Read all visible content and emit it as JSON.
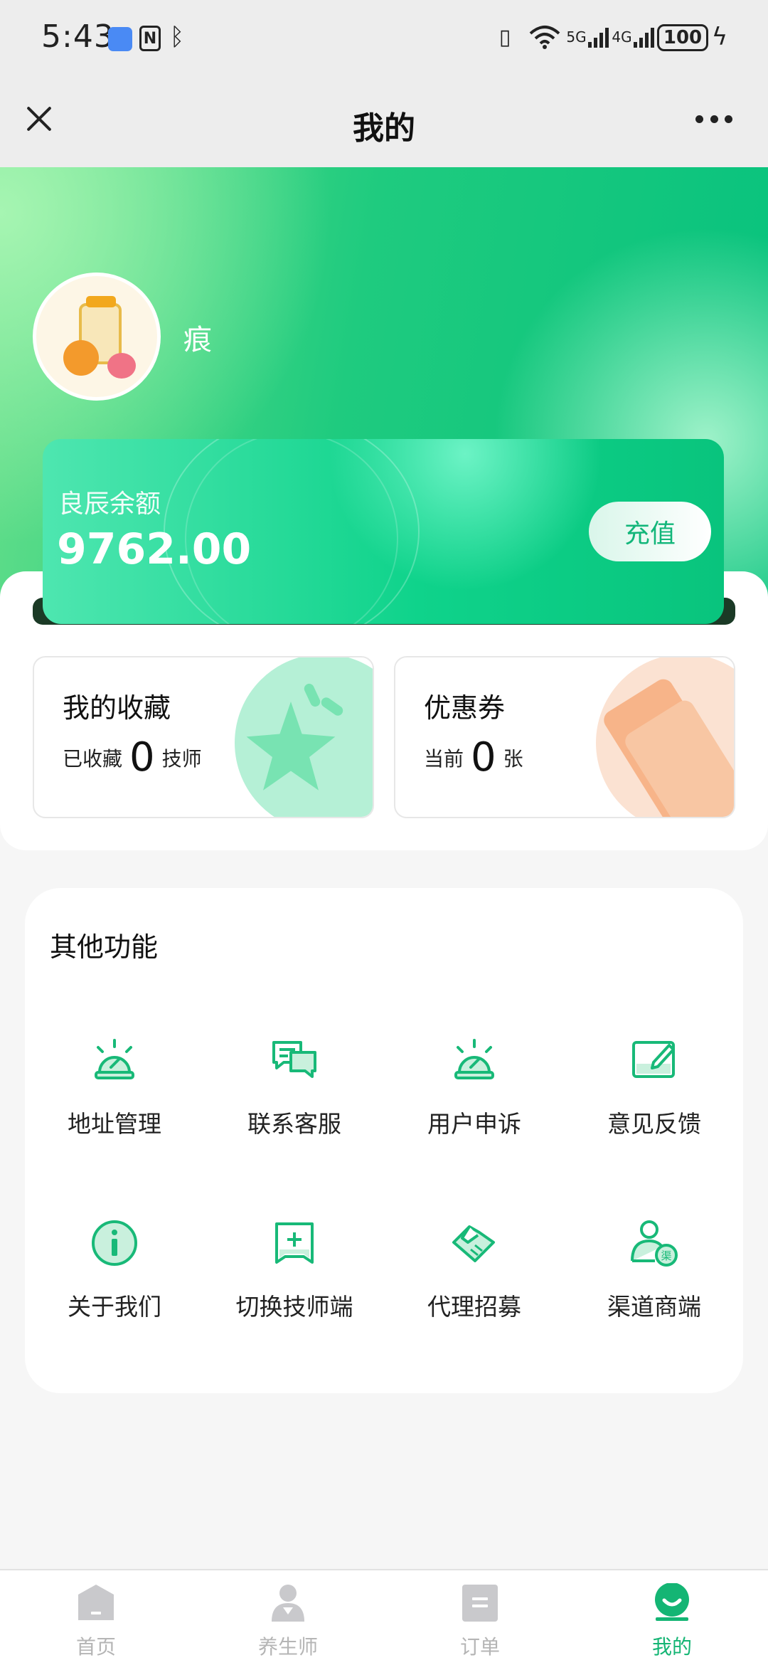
{
  "status_bar": {
    "time": "5:43",
    "signal_5g_label": "5G",
    "signal_4g_label": "4G",
    "battery": "100"
  },
  "header": {
    "title": "我的"
  },
  "profile": {
    "username": "痕"
  },
  "balance": {
    "label": "良辰余额",
    "amount": "9762.00",
    "recharge_label": "充值"
  },
  "favorites": {
    "title": "我的收藏",
    "prefix": "已收藏",
    "count": "0",
    "suffix": "技师"
  },
  "coupons": {
    "title": "优惠券",
    "prefix": "当前",
    "count": "0",
    "suffix": "张"
  },
  "functions": {
    "title": "其他功能",
    "items": [
      {
        "label": "地址管理",
        "icon": "alarm-icon"
      },
      {
        "label": "联系客服",
        "icon": "chat-icon"
      },
      {
        "label": "用户申诉",
        "icon": "alarm-icon"
      },
      {
        "label": "意见反馈",
        "icon": "edit-icon"
      },
      {
        "label": "关于我们",
        "icon": "info-icon"
      },
      {
        "label": "切换技师端",
        "icon": "switch-icon"
      },
      {
        "label": "代理招募",
        "icon": "handshake-icon"
      },
      {
        "label": "渠道商端",
        "icon": "channel-user-icon"
      }
    ]
  },
  "tabs": [
    {
      "label": "首页",
      "icon": "home-icon",
      "active": false
    },
    {
      "label": "养生师",
      "icon": "therapist-icon",
      "active": false
    },
    {
      "label": "订单",
      "icon": "order-icon",
      "active": false
    },
    {
      "label": "我的",
      "icon": "profile-icon",
      "active": true
    }
  ],
  "colors": {
    "accent": "#14b574",
    "hero_green": "#07c27d",
    "coupon_orange": "#f7b489"
  }
}
